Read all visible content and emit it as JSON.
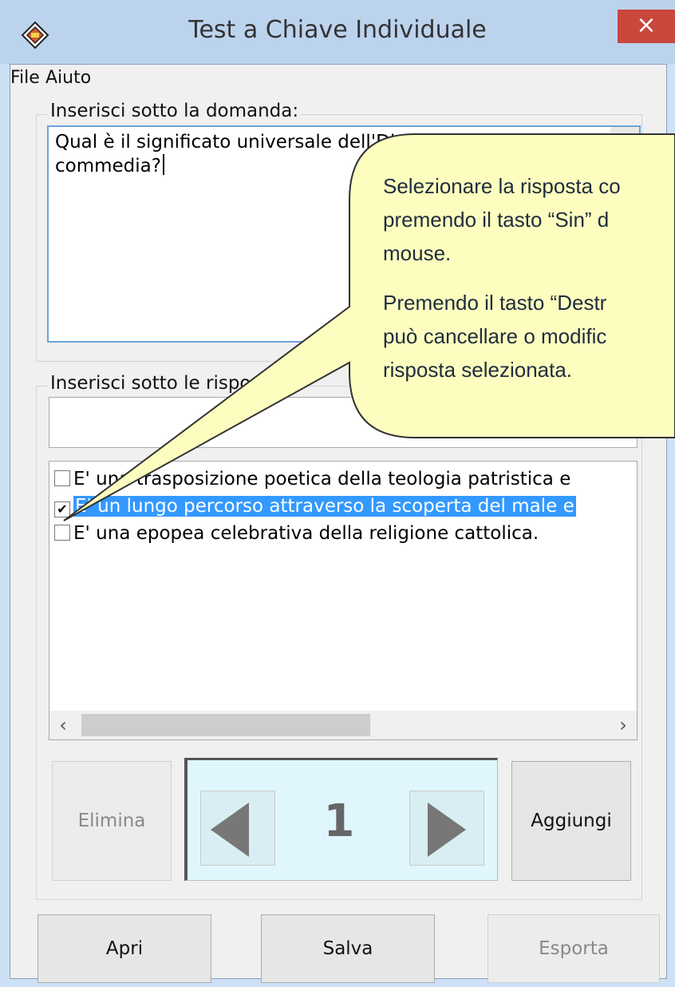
{
  "window": {
    "title": "Test a Chiave Individuale",
    "close_label": "×"
  },
  "menu": {
    "file": "File",
    "help": "Aiuto"
  },
  "question": {
    "group_label": "Inserisci sotto la domanda:",
    "line1": "Qual è il significato universale dell'Divina",
    "line2": "commedia?"
  },
  "answers": {
    "group_label": "Inserisci sotto le risposte:",
    "input_value": "",
    "items": [
      {
        "label": "E' una trasposizione poetica della teologia patristica e",
        "checked": false,
        "check": ""
      },
      {
        "label": "E' un lungo percorso attraverso la scoperta del male e",
        "checked": true,
        "check": "✔"
      },
      {
        "label": "E' una epopea celebrativa della religione cattolica.",
        "checked": false,
        "check": ""
      }
    ],
    "scroll_left": "‹",
    "scroll_right": "›"
  },
  "nav": {
    "delete_label": "Elimina",
    "page_number": "1",
    "add_label": "Aggiungi"
  },
  "footer": {
    "open_label": "Apri",
    "save_label": "Salva",
    "export_label": "Esporta"
  },
  "callout": {
    "para1": [
      "Selezionare la risposta co",
      "premendo il tasto “Sin” d",
      "mouse."
    ],
    "para2": [
      "Premendo il tasto “Destr",
      "può cancellare o modific",
      "risposta selezionata."
    ]
  },
  "colors": {
    "titlebar": "#bcd3ee",
    "close": "#c9473d",
    "selection": "#3399ff",
    "callout_fill": "#fdfdc0",
    "nav_panel": "#dff7fc"
  }
}
